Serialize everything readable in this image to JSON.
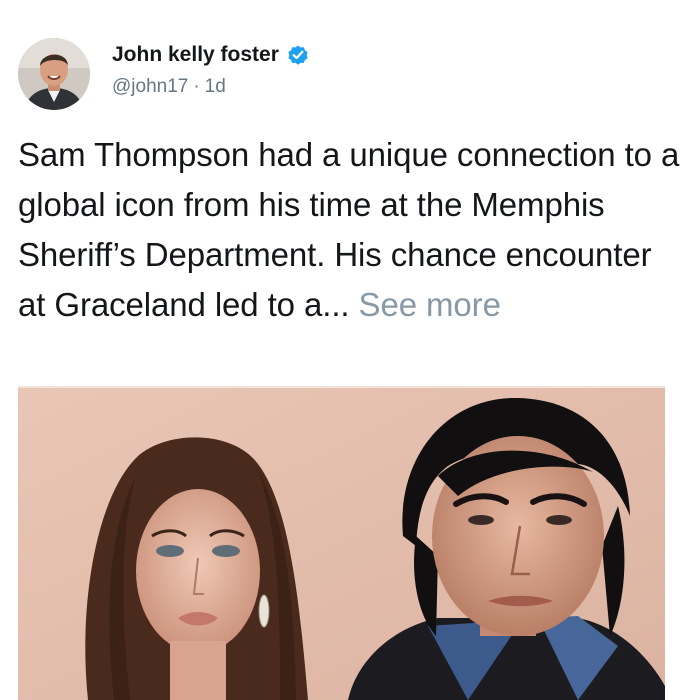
{
  "post": {
    "author": {
      "display_name": "John kelly foster",
      "handle": "@john17",
      "verified": true,
      "avatar_icon": "user-avatar-photo",
      "verified_icon": "verified-badge-icon",
      "verified_color": "#1da1f2"
    },
    "separator": "·",
    "timestamp": "1d",
    "text": "Sam Thompson had a unique connection to a global icon from his time at the Memphis Sheriff’s Department. His chance encounter at Graceland led to a...",
    "see_more_label": "See more",
    "colors": {
      "text": "#14171a",
      "secondary": "#657786",
      "see_more": "#8899a6"
    },
    "media": {
      "type": "photo",
      "icon": "attached-photo"
    }
  }
}
